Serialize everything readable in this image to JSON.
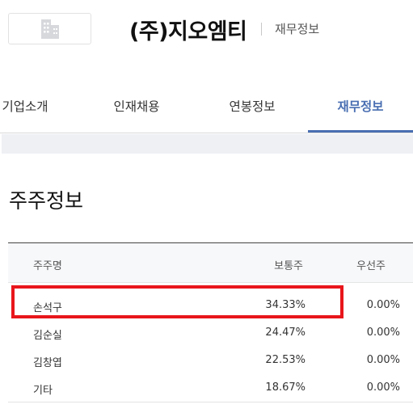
{
  "header": {
    "company_name": "(주)지오엠티",
    "section_label": "재무정보",
    "logo_icon": "building-icon"
  },
  "tabs": [
    {
      "label": "기업소개",
      "active": false
    },
    {
      "label": "인재채용",
      "active": false
    },
    {
      "label": "연봉정보",
      "active": false
    },
    {
      "label": "재무정보",
      "active": true
    }
  ],
  "section": {
    "title": "주주정보"
  },
  "table": {
    "columns": [
      "주주명",
      "보통주",
      "우선주"
    ],
    "rows": [
      {
        "name": "손석구",
        "common": "34.33%",
        "preferred": "0.00%",
        "highlighted": true
      },
      {
        "name": "김순실",
        "common": "24.47%",
        "preferred": "0.00%"
      },
      {
        "name": "김창엽",
        "common": "22.53%",
        "preferred": "0.00%"
      },
      {
        "name": "기타",
        "common": "18.67%",
        "preferred": "0.00%"
      }
    ]
  },
  "colors": {
    "accent": "#4a6fb2",
    "highlight": "#e8161b",
    "band": "#eef0f4"
  }
}
